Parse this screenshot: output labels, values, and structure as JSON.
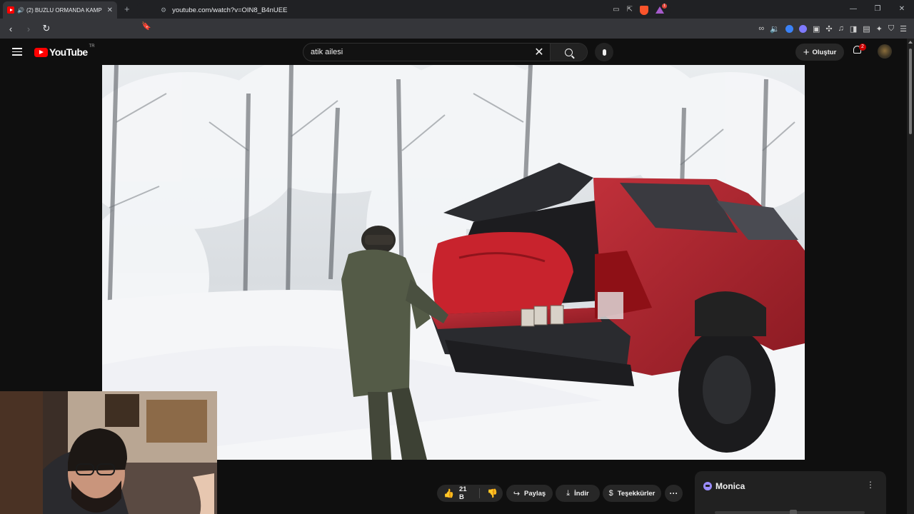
{
  "browser": {
    "tab_title": "(2) BUZLU ORMANDA KAMP",
    "tab_close": "✕",
    "new_tab": "+",
    "url": "youtube.com/watch?v=OIN8_B4nUEE"
  },
  "youtube": {
    "logo_text": "YouTube",
    "country_code": "TR",
    "search_query": "atik ailesi",
    "create_label": "Oluştur",
    "notification_count": "2"
  },
  "actions": {
    "like_count": "21 B",
    "share_label": "Paylaş",
    "download_label": "İndir",
    "thanks_label": "Teşekkürler",
    "more_label": "···"
  },
  "monica": {
    "title": "Monica",
    "menu": "⋮"
  },
  "icons": {
    "brand": "#ff0000",
    "monica": "#9b8cff",
    "truck_red": "#b0232e"
  }
}
